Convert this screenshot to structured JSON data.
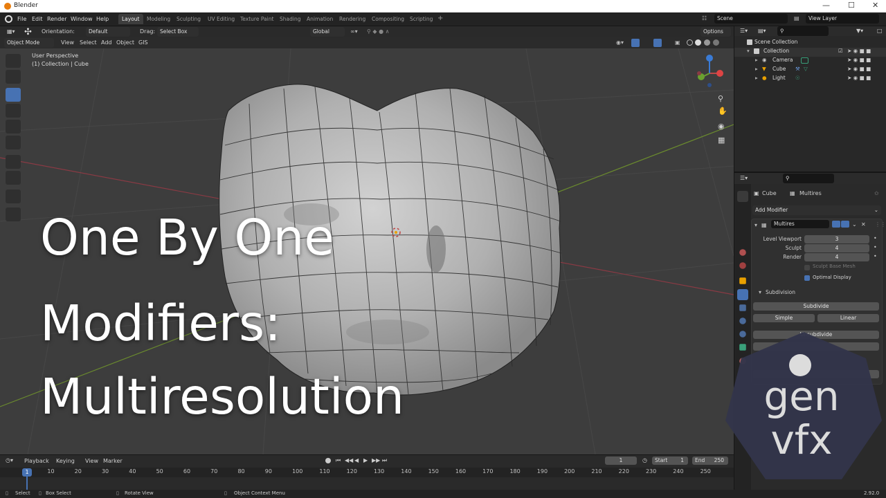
{
  "window": {
    "title": "Blender",
    "version": "2.92.0"
  },
  "menu": {
    "items": [
      "File",
      "Edit",
      "Render",
      "Window",
      "Help"
    ]
  },
  "workspaces": [
    "Layout",
    "Modeling",
    "Sculpting",
    "UV Editing",
    "Texture Paint",
    "Shading",
    "Animation",
    "Rendering",
    "Compositing",
    "Scripting"
  ],
  "active_workspace": "Layout",
  "scene": {
    "name": "Scene",
    "view_layer": "View Layer"
  },
  "tool_settings": {
    "orientation_label": "Orientation:",
    "orientation_value": "Default",
    "drag_label": "Drag:",
    "drag_value": "Select Box",
    "transform_orientation": "Global",
    "options": "Options"
  },
  "viewport_header": {
    "mode": "Object Mode",
    "menus": [
      "View",
      "Select",
      "Add",
      "Object",
      "GIS"
    ]
  },
  "viewport": {
    "perspective": "User Perspective",
    "context": "(1) Collection | Cube"
  },
  "overlay_title": [
    "One By One",
    "Modifiers:",
    "Multiresolution"
  ],
  "outliner": {
    "scene_collection": "Scene Collection",
    "collection": "Collection",
    "objects": [
      "Camera",
      "Cube",
      "Light"
    ]
  },
  "properties": {
    "breadcrumb_object": "Cube",
    "breadcrumb_modifier": "Multires",
    "add_modifier": "Add Modifier",
    "modifier_name": "Multires",
    "fields": [
      {
        "label": "Level Viewport",
        "value": "3"
      },
      {
        "label": "Sculpt",
        "value": "4"
      },
      {
        "label": "Render",
        "value": "4"
      }
    ],
    "sculpt_base_mesh": "Sculpt Base Mesh",
    "optimal_display": "Optimal Display",
    "subdivision_panel": "Subdivision",
    "subdivide": "Subdivide",
    "simple": "Simple",
    "linear": "Linear",
    "unsubdivide": "Unsubdivide"
  },
  "timeline": {
    "menus": [
      "Playback",
      "Keying",
      "View",
      "Marker"
    ],
    "current_frame": "1",
    "start_label": "Start",
    "start": "1",
    "end_label": "End",
    "end": "250",
    "frames": [
      "10",
      "20",
      "30",
      "40",
      "50",
      "60",
      "70",
      "80",
      "90",
      "100",
      "110",
      "120",
      "130",
      "140",
      "150",
      "160",
      "170",
      "180",
      "190",
      "200",
      "210",
      "220",
      "230",
      "240",
      "250"
    ],
    "playhead": "1"
  },
  "statusbar": {
    "select": "Select",
    "box_select": "Box Select",
    "rotate_view": "Rotate View",
    "context_menu": "Object Context Menu"
  },
  "logo": {
    "line1": "gen",
    "line2": "vfx"
  },
  "colors": {
    "accent": "#4772b3",
    "logo_bg": "#33354a",
    "title_text": "#ffffff"
  }
}
